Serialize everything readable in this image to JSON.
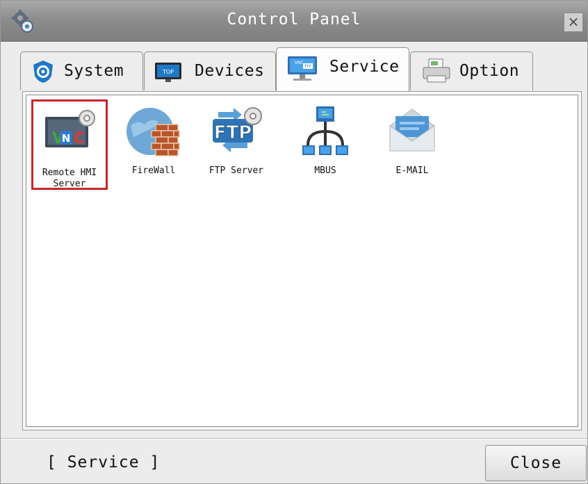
{
  "window": {
    "title": "Control Panel",
    "close_glyph": "×"
  },
  "tabs": [
    {
      "label": "System",
      "icon": "gear-shield-icon",
      "active": false
    },
    {
      "label": "Devices",
      "icon": "top-monitor-icon",
      "active": false
    },
    {
      "label": "Service",
      "icon": "vnc-monitor-icon",
      "active": true
    },
    {
      "label": "Option",
      "icon": "printer-icon",
      "active": false
    }
  ],
  "services": [
    {
      "label": "Remote HMI Server",
      "icon": "vnc-server-icon",
      "selected": true
    },
    {
      "label": "FireWall",
      "icon": "firewall-icon",
      "selected": false
    },
    {
      "label": "FTP Server",
      "icon": "ftp-server-icon",
      "selected": false
    },
    {
      "label": "MBUS",
      "icon": "network-tree-icon",
      "selected": false
    },
    {
      "label": "E-MAIL",
      "icon": "envelope-icon",
      "selected": false
    }
  ],
  "status": {
    "text": "[ Service ]"
  },
  "footer": {
    "close_label": "Close"
  },
  "colors": {
    "selection_border": "#c8252c",
    "titlebar": "#8d8d8d"
  }
}
